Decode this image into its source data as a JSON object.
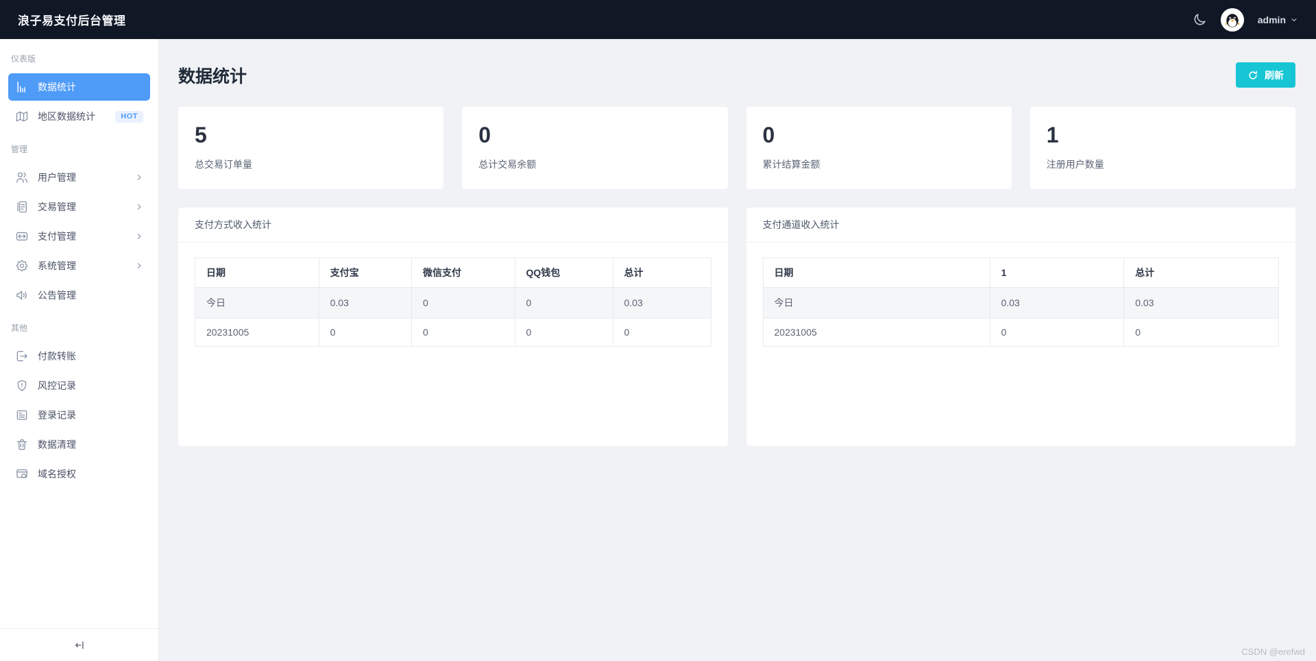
{
  "header": {
    "title": "浪子易支付后台管理",
    "user": "admin"
  },
  "sidebar": {
    "sections": [
      {
        "label": "仪表版",
        "items": [
          {
            "label": "数据统计",
            "icon": "bar-chart-icon",
            "active": true
          },
          {
            "label": "地区数据统计",
            "icon": "map-icon",
            "badge": "HOT"
          }
        ]
      },
      {
        "label": "管理",
        "items": [
          {
            "label": "用户管理",
            "icon": "users-icon",
            "expandable": true
          },
          {
            "label": "交易管理",
            "icon": "document-icon",
            "expandable": true
          },
          {
            "label": "支付管理",
            "icon": "transfer-icon",
            "expandable": true
          },
          {
            "label": "系统管理",
            "icon": "gear-icon",
            "expandable": true
          },
          {
            "label": "公告管理",
            "icon": "megaphone-icon",
            "expandable": false
          }
        ]
      },
      {
        "label": "其他",
        "items": [
          {
            "label": "付款转账",
            "icon": "payout-icon"
          },
          {
            "label": "风控记录",
            "icon": "shield-alert-icon"
          },
          {
            "label": "登录记录",
            "icon": "log-card-icon"
          },
          {
            "label": "数据清理",
            "icon": "trash-icon"
          },
          {
            "label": "域名授权",
            "icon": "domain-window-icon"
          }
        ]
      }
    ]
  },
  "main": {
    "page_title": "数据统计",
    "refresh_button_label": "刷新",
    "stat_cards": [
      {
        "value": "5",
        "label": "总交易订单量"
      },
      {
        "value": "0",
        "label": "总计交易余额"
      },
      {
        "value": "0",
        "label": "累计结算金额"
      },
      {
        "value": "1",
        "label": "注册用户数量"
      }
    ],
    "panels": [
      {
        "title": "支付方式收入统计",
        "table": {
          "headers": [
            "日期",
            "支付宝",
            "微信支付",
            "QQ钱包",
            "总计"
          ],
          "rows": [
            [
              "今日",
              "0.03",
              "0",
              "0",
              "0.03"
            ],
            [
              "20231005",
              "0",
              "0",
              "0",
              "0"
            ]
          ]
        }
      },
      {
        "title": "支付通道收入统计",
        "table": {
          "headers": [
            "日期",
            "1",
            "总计"
          ],
          "rows": [
            [
              "今日",
              "0.03",
              "0.03"
            ],
            [
              "20231005",
              "0",
              "0"
            ]
          ]
        }
      }
    ]
  },
  "watermark": "CSDN @erefwd",
  "colors": {
    "accent_blue": "#4e9bf8",
    "refresh_cyan": "#17c5d4",
    "header_bg": "#101725",
    "content_bg": "#f0f2f5"
  }
}
